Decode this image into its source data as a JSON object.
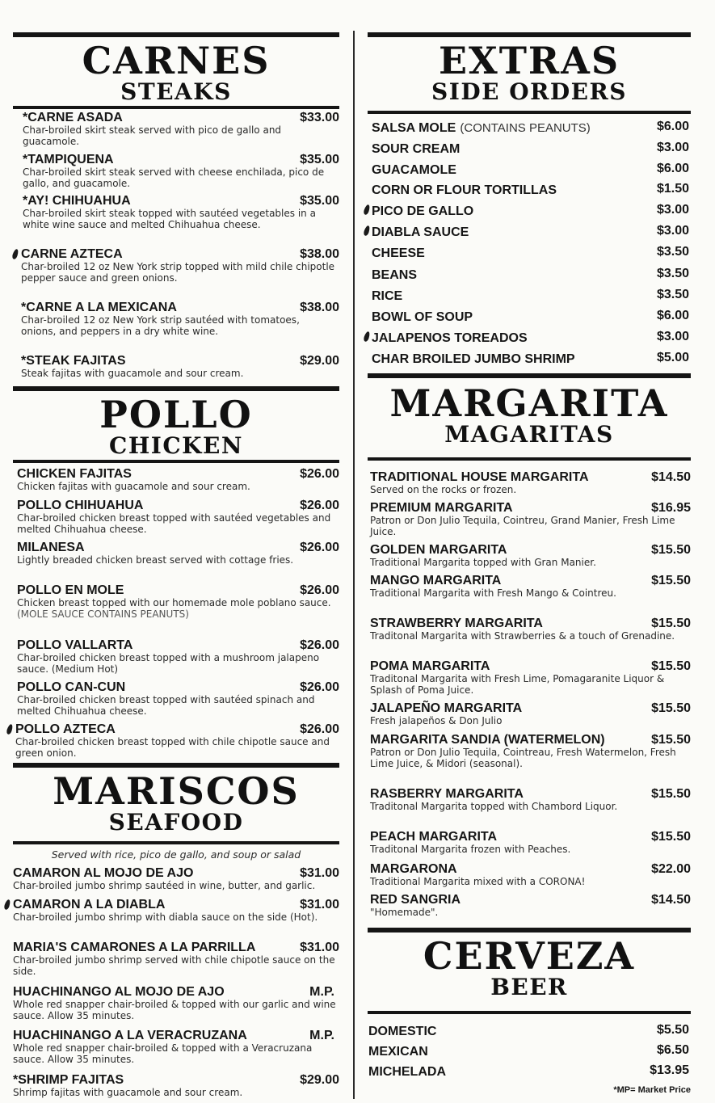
{
  "carnes": {
    "title": "CARNES",
    "subtitle": "STEAKS",
    "items": [
      {
        "name": "*CARNE ASADA",
        "price": "$33.00",
        "desc": "Char-broiled skirt steak served with pico de gallo and guacamole."
      },
      {
        "name": "*TAMPIQUENA",
        "price": "$35.00",
        "desc": "Char-broiled skirt steak served with cheese enchilada, pico de gallo, and guacamole."
      },
      {
        "name": "*AY! CHIHUAHUA",
        "price": "$35.00",
        "desc": "Char-broiled skirt steak topped with sautéed vegetables in a white wine sauce and melted Chihuahua cheese."
      },
      {
        "name": "CARNE AZTECA",
        "price": "$38.00",
        "desc": "Char-broiled 12 oz New York strip topped with mild chile chipotle pepper sauce and green onions."
      },
      {
        "name": "*CARNE A LA MEXICANA",
        "price": "$38.00",
        "desc": "Char-broiled 12 oz New York strip sautéed with tomatoes, onions, and peppers in a dry white wine."
      },
      {
        "name": "*STEAK FAJITAS",
        "price": "$29.00",
        "desc": "Steak fajitas with guacamole and sour cream."
      }
    ]
  },
  "pollo": {
    "title": "POLLO",
    "subtitle": "CHICKEN",
    "items": [
      {
        "name": "CHICKEN FAJITAS",
        "price": "$26.00",
        "desc": "Chicken fajitas with guacamole and sour cream."
      },
      {
        "name": "POLLO CHIHUAHUA",
        "price": "$26.00",
        "desc": "Char-broiled chicken breast topped with sautéed vegetables and melted Chihuahua cheese."
      },
      {
        "name": "MILANESA",
        "price": "$26.00",
        "desc": "Lightly breaded chicken breast served with cottage fries."
      },
      {
        "name": "POLLO EN MOLE",
        "price": "$26.00",
        "desc": "Chicken breast topped with our homemade mole poblano sauce.",
        "note": "(MOLE SAUCE CONTAINS PEANUTS)"
      },
      {
        "name": "POLLO VALLARTA",
        "price": "$26.00",
        "desc": "Char-broiled chicken breast topped with a mushroom jalapeno sauce. (Medium Hot)"
      },
      {
        "name": "POLLO CAN-CUN",
        "price": "$26.00",
        "desc": "Char-broiled chicken breast topped with sautéed spinach and melted Chihuahua cheese."
      },
      {
        "name": "POLLO AZTECA",
        "price": "$26.00",
        "desc": "Char-broiled chicken breast topped with chile chipotle sauce and green onion."
      }
    ]
  },
  "mariscos": {
    "title": "MARISCOS",
    "subtitle": "SEAFOOD",
    "note": "Served with rice, pico de gallo, and soup or salad",
    "items": [
      {
        "name": "CAMARON AL MOJO DE AJO",
        "price": "$31.00",
        "desc": "Char-broiled jumbo shrimp sautéed in wine, butter, and garlic."
      },
      {
        "name": "CAMARON A LA DIABLA",
        "price": "$31.00",
        "desc": "Char-broiled jumbo shrimp with diabla sauce on the side (Hot)."
      },
      {
        "name": "MARIA'S CAMARONES A LA PARRILLA",
        "price": "$31.00",
        "desc": "Char-broiled jumbo shrimp served with chile chipotle sauce on the side."
      },
      {
        "name": "HUACHINANGO AL MOJO DE AJO",
        "price": "M.P.",
        "desc": "Whole red snapper chair-broiled & topped with our garlic and wine sauce. Allow 35 minutes."
      },
      {
        "name": "HUACHINANGO A LA VERACRUZANA",
        "price": "M.P.",
        "desc": "Whole red snapper chair-broiled & topped with a Veracruzana sauce. Allow 35 minutes."
      },
      {
        "name": "*SHRIMP FAJITAS",
        "price": "$29.00",
        "desc": "Shrimp fajitas with guacamole and sour cream."
      }
    ]
  },
  "extras": {
    "title": "EXTRAS",
    "subtitle": "SIDE ORDERS",
    "items": [
      {
        "name": "SALSA MOLE",
        "note": "(CONTAINS PEANUTS)",
        "price": "$6.00"
      },
      {
        "name": "SOUR CREAM",
        "price": "$3.00"
      },
      {
        "name": "GUACAMOLE",
        "price": "$6.00"
      },
      {
        "name": "CORN OR FLOUR TORTILLAS",
        "price": "$1.50"
      },
      {
        "name": "PICO DE GALLO",
        "price": "$3.00"
      },
      {
        "name": "DIABLA SAUCE",
        "price": "$3.00"
      },
      {
        "name": "CHEESE",
        "price": "$3.50"
      },
      {
        "name": "BEANS",
        "price": "$3.50"
      },
      {
        "name": "RICE",
        "price": "$3.50"
      },
      {
        "name": "BOWL OF SOUP",
        "price": "$6.00"
      },
      {
        "name": "JALAPENOS TOREADOS",
        "price": "$3.00"
      },
      {
        "name": "CHAR BROILED JUMBO SHRIMP",
        "price": "$5.00"
      }
    ]
  },
  "margarita": {
    "title": "MARGARITA",
    "subtitle": "MAGARITAS",
    "items": [
      {
        "name": "TRADITIONAL HOUSE MARGARITA",
        "price": "$14.50",
        "desc": "Served on the rocks or frozen."
      },
      {
        "name": "PREMIUM MARGARITA",
        "price": "$16.95",
        "desc": "Patron or Don Julio Tequila, Cointreu, Grand Manier, Fresh Lime Juice."
      },
      {
        "name": "GOLDEN MARGARITA",
        "price": "$15.50",
        "desc": "Traditional Margarita topped with Gran Manier."
      },
      {
        "name": "MANGO MARGARITA",
        "price": "$15.50",
        "desc": "Traditional Margarita with Fresh Mango & Cointreu."
      },
      {
        "name": "STRAWBERRY MARGARITA",
        "price": "$15.50",
        "desc": "Traditonal Margarita with Strawberries & a touch of Grenadine."
      },
      {
        "name": "POMA MARGARITA",
        "price": "$15.50",
        "desc": "Traditonal Margarita with Fresh Lime, Pomagaranite Liquor & Splash of Poma Juice."
      },
      {
        "name": "JALAPEÑO MARGARITA",
        "price": "$15.50",
        "desc": "Fresh jalapeños & Don Julio"
      },
      {
        "name": "MARGARITA SANDIA (WATERMELON)",
        "price": "$15.50",
        "desc": "Patron or Don Julio Tequila, Cointreau, Fresh Watermelon, Fresh Lime Juice, & Midori (seasonal)."
      },
      {
        "name": "RASBERRY MARGARITA",
        "price": "$15.50",
        "desc": "Traditonal Margarita topped with Chambord Liquor."
      },
      {
        "name": "PEACH MARGARITA",
        "price": "$15.50",
        "desc": "Traditonal Margarita frozen with Peaches."
      },
      {
        "name": "MARGARONA",
        "price": "$22.00",
        "desc": "Traditional Margarita mixed with a CORONA!"
      },
      {
        "name": "RED SANGRIA",
        "price": "$14.50",
        "desc": "\"Homemade\"."
      }
    ]
  },
  "cerveza": {
    "title": "CERVEZA",
    "subtitle": "BEER",
    "items": [
      {
        "name": "DOMESTIC",
        "price": "$5.50"
      },
      {
        "name": "MEXICAN",
        "price": "$6.50"
      },
      {
        "name": "MICHELADA",
        "price": "$13.95"
      }
    ]
  },
  "footnote": "*MP= Market Price"
}
